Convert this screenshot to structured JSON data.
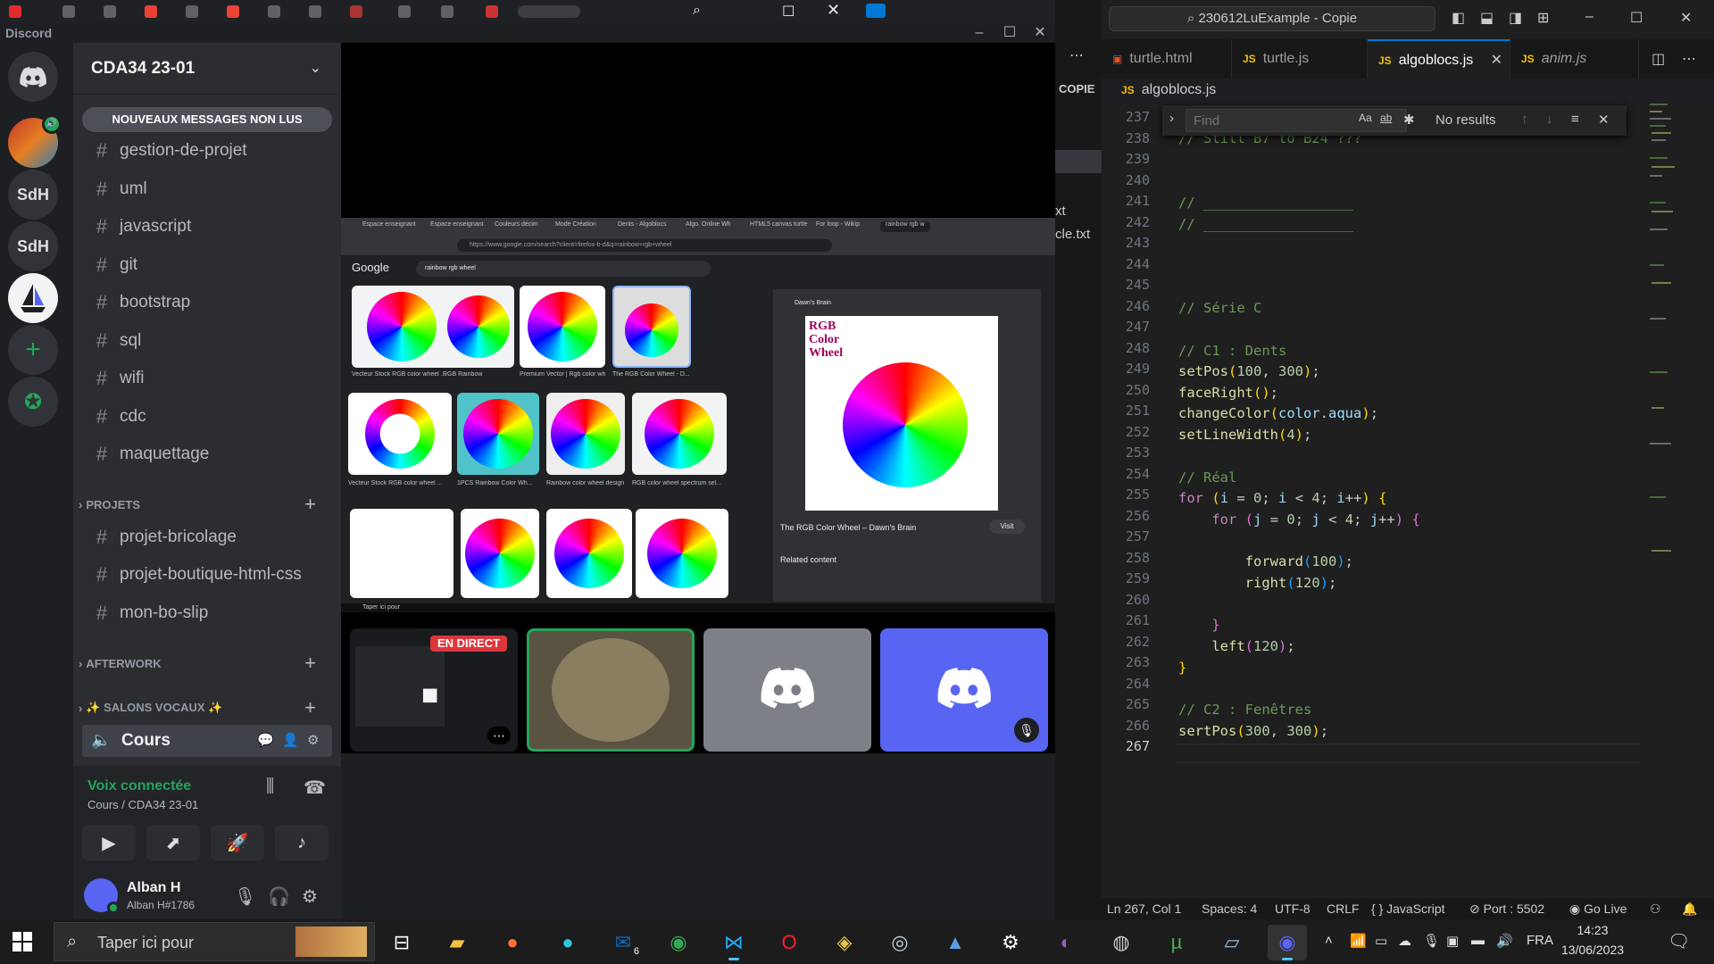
{
  "discord": {
    "app_title": "Discord",
    "server_name": "CDA34 23-01",
    "guild_labels": [
      "SdH",
      "SdH"
    ],
    "unread_pill": "NOUVEAUX MESSAGES NON LUS",
    "channels": [
      "gestion-de-projet",
      "uml",
      "javascript",
      "git",
      "bootstrap",
      "sql",
      "wifi",
      "cdc",
      "maquettage"
    ],
    "categories": {
      "projets": "PROJETS",
      "afterwork": "AFTERWORK",
      "voice": "✨ SALONS VOCAUX ✨"
    },
    "project_channels": [
      "projet-bricolage",
      "projet-boutique-html-css",
      "mon-bo-slip"
    ],
    "voice_channel": "Cours",
    "voice_status": "Voix connectée",
    "voice_location": "Cours / CDA34 23-01",
    "user": {
      "name": "Alban H",
      "tag": "Alban H#1786"
    },
    "live_badge": "EN DIRECT"
  },
  "shared_screen": {
    "tabs": [
      "Espace enseignant",
      "Espace enseignant",
      "Couleurs décim",
      "Mode Création",
      "Dents - Algoblocs",
      "Algo. Online Wh",
      "HTML5 canvas turtle",
      "For loop - Wikip",
      "rainbow rgb w"
    ],
    "url": "https://www.google.com/search?client=firefox-b-d&q=rainbow+rgb+wheel",
    "google_logo": "Google",
    "search_query": "rainbow rgb wheel",
    "thumb_captions": [
      "Vecteur Stock RGB color wheel ...",
      "RGB Rainbow",
      "Premium Vector | Rgb color wh...",
      "The RGB Color Wheel - D...",
      "Vecteur Stock RGB color wheel ...",
      "1PCS Rainbow Color Wh...",
      "Rainbow color wheel design e...",
      "RGB color wheel spectrum sel..."
    ],
    "panel_source": "Dawn's Brain",
    "panel_image_title": "RGB Color Wheel",
    "panel_caption": "The RGB Color Wheel – Dawn's Brain",
    "panel_visit": "Visit",
    "panel_related": "Related content",
    "taskbar_search": "Taper ici pour"
  },
  "vscode": {
    "explorer_label": "COPIE",
    "explorer_files": [
      "xt",
      "cle.txt"
    ],
    "search_box": "230612LuExample - Copie",
    "tabs": [
      {
        "label": "turtle.html",
        "icon": "html-icon",
        "active": false
      },
      {
        "label": "turtle.js",
        "icon": "js-icon",
        "active": false
      },
      {
        "label": "algoblocs.js",
        "icon": "js-icon",
        "active": true
      },
      {
        "label": "anim.js",
        "icon": "js-icon",
        "active": false
      }
    ],
    "breadcrumb": "algoblocs.js",
    "find": {
      "placeholder": "Find",
      "results": "No results"
    },
    "line_numbers": [
      "237",
      "238",
      "239",
      "240",
      "241",
      "242",
      "243",
      "244",
      "245",
      "246",
      "247",
      "248",
      "249",
      "250",
      "251",
      "252",
      "253",
      "254",
      "255",
      "256",
      "257",
      "258",
      "259",
      "260",
      "261",
      "262",
      "263",
      "264",
      "265",
      "266",
      "267"
    ],
    "status": {
      "position": "Ln 267, Col 1",
      "spaces": "Spaces: 4",
      "encoding": "UTF-8",
      "eol": "CRLF",
      "language": "{ } JavaScript",
      "port": "Port : 5502",
      "golive": "Go Live"
    }
  },
  "taskbar": {
    "search_placeholder": "Taper ici pour",
    "mail_badge": "6",
    "language": "FRA",
    "time": "14:23",
    "date": "13/06/2023"
  },
  "colors": {
    "discord_blurple": "#5865f2",
    "discord_green": "#23a55a",
    "live_red": "#da373c",
    "vscode_accent": "#0078d4"
  }
}
